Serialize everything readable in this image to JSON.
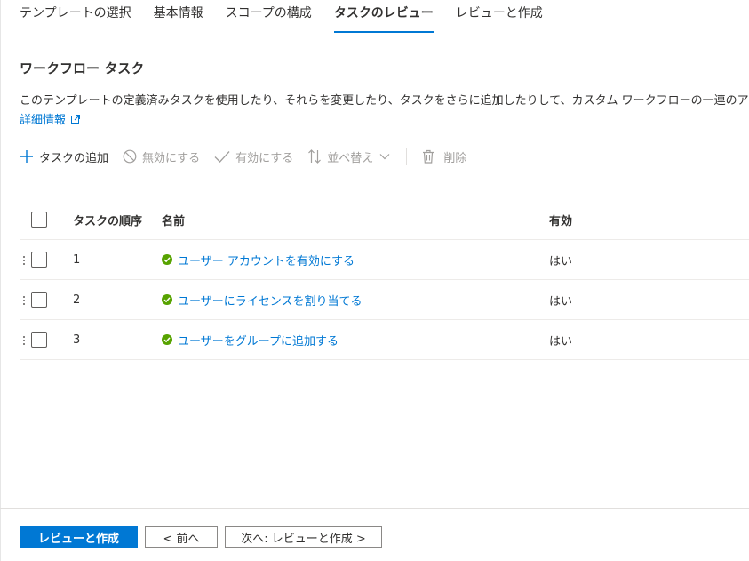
{
  "tabs": [
    {
      "label": "テンプレートの選択",
      "active": false
    },
    {
      "label": "基本情報",
      "active": false
    },
    {
      "label": "スコープの構成",
      "active": false
    },
    {
      "label": "タスクのレビュー",
      "active": true
    },
    {
      "label": "レビューと作成",
      "active": false
    }
  ],
  "section": {
    "title": "ワークフロー タスク",
    "description": "このテンプレートの定義済みタスクを使用したり、それらを変更したり、タスクをさらに追加したりして、カスタム ワークフローの一連のア",
    "learn_more": "詳細情報"
  },
  "toolbar": {
    "add_task": "タスクの追加",
    "disable": "無効にする",
    "enable": "有効にする",
    "reorder": "並べ替え",
    "delete": "削除"
  },
  "table": {
    "headers": {
      "order": "タスクの順序",
      "name": "名前",
      "enabled": "有効"
    },
    "rows": [
      {
        "order": "1",
        "name": "ユーザー アカウントを有効にする",
        "enabled": "はい"
      },
      {
        "order": "2",
        "name": "ユーザーにライセンスを割り当てる",
        "enabled": "はい"
      },
      {
        "order": "3",
        "name": "ユーザーをグループに追加する",
        "enabled": "はい"
      }
    ]
  },
  "footer": {
    "review_create": "レビューと作成",
    "previous": "< 前へ",
    "next": "次へ: レビューと作成 >"
  },
  "colors": {
    "accent": "#0078d4",
    "success": "#57a300",
    "disabled_text": "#a19f9d"
  },
  "icons": {
    "add": "plus-icon",
    "disable": "block-icon",
    "enable": "checkmark-icon",
    "reorder": "sort-arrows-icon",
    "reorder_caret": "chevron-down-icon",
    "delete": "trash-icon",
    "learn_more": "open-in-new-icon",
    "status": "check-circle-icon"
  }
}
